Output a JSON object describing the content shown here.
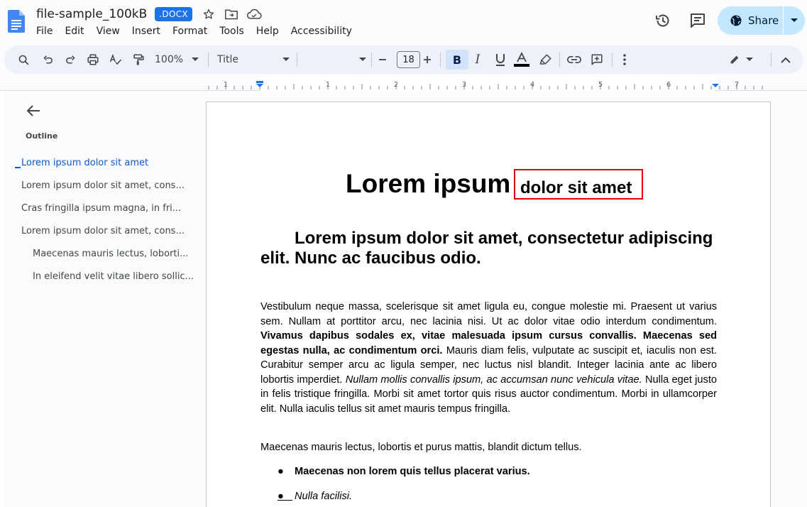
{
  "header": {
    "doc_title": "file-sample_100kB",
    "file_badge": ".DOCX",
    "menu": [
      "File",
      "Edit",
      "View",
      "Insert",
      "Format",
      "Tools",
      "Help",
      "Accessibility"
    ],
    "share_label": "Share"
  },
  "toolbar": {
    "zoom": "100%",
    "style": "Title",
    "font_size": "18"
  },
  "ruler": {
    "numbers": [
      "1",
      "1",
      "2",
      "3",
      "4",
      "5",
      "6",
      "7"
    ]
  },
  "outline": {
    "label": "Outline",
    "items": [
      "Lorem ipsum dolor sit amet",
      "Lorem ipsum dolor sit amet, cons...",
      "Cras fringilla ipsum magna, in fri...",
      "Lorem ipsum dolor sit amet, cons...",
      "Maecenas mauris lectus, loborti...",
      "In eleifend velit vitae libero sollic..."
    ]
  },
  "document": {
    "title_part1": "Lorem ipsum",
    "title_part2": "dolor sit amet",
    "heading": "Lorem ipsum dolor sit amet, consectetur adipiscing elit. Nunc ac faucibus odio.",
    "p1_a": "Vestibulum neque massa, scelerisque sit amet ligula eu, congue molestie mi. Praesent ut varius sem. Nullam at porttitor arcu, nec lacinia nisi. Ut ac dolor vitae odio interdum condimentum. ",
    "p1_b": "Vivamus dapibus sodales ex, vitae malesuada ipsum cursus convallis. Maecenas sed egestas nulla, ac condimentum orci.",
    "p1_c": " Mauris diam felis, vulputate ac suscipit et, iaculis non est. Curabitur semper arcu ac ligula semper, nec luctus nisl blandit. Integer lacinia ante ac libero lobortis imperdiet. ",
    "p1_d": "Nullam mollis convallis ipsum, ac accumsan nunc vehicula vitae.",
    "p1_e": " Nulla eget justo in felis tristique fringilla. Morbi sit amet tortor quis risus auctor condimentum. Morbi in ullamcorper elit. Nulla iaculis tellus sit amet mauris tempus fringilla.",
    "p2": "Maecenas mauris lectus, lobortis et purus mattis, blandit dictum tellus.",
    "bullet1": "Maecenas non lorem quis tellus placerat varius.",
    "bullet2": "Nulla facilisi."
  }
}
